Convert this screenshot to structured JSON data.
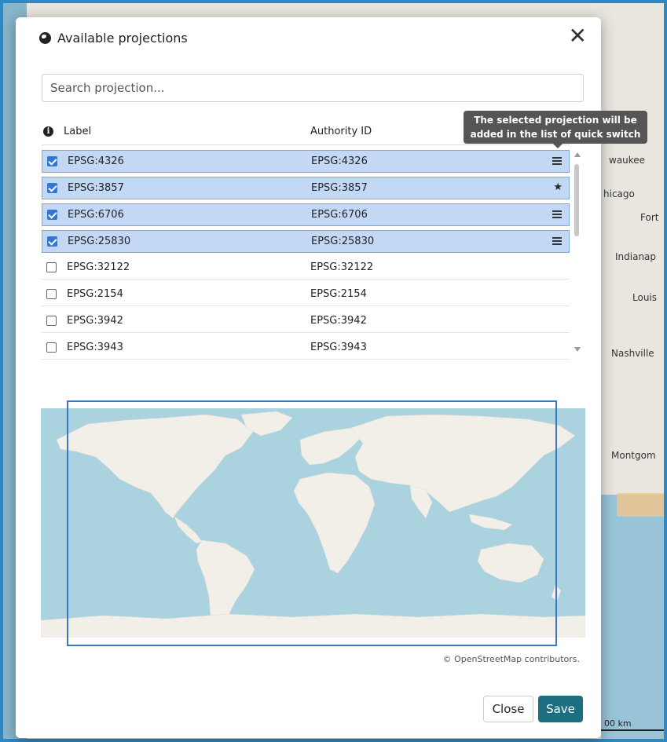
{
  "background": {
    "cities": [
      "waukee",
      "hicago",
      "Fort",
      "Indianap",
      "Louis",
      "Nashville",
      "Montgom"
    ],
    "scale_label": "00 km"
  },
  "dialog": {
    "title": "Available projections",
    "close_glyph": "✕",
    "search": {
      "placeholder": "Search projection...",
      "value": ""
    },
    "columns": {
      "label": "Label",
      "authority": "Authority ID"
    },
    "tooltip": {
      "line1": "The selected projection will be",
      "line2": "added in the list of quick switch"
    },
    "rows": [
      {
        "label": "EPSG:4326",
        "authority": "EPSG:4326",
        "selected": true,
        "action": "list-icon"
      },
      {
        "label": "EPSG:3857",
        "authority": "EPSG:3857",
        "selected": true,
        "action": "star-icon"
      },
      {
        "label": "EPSG:6706",
        "authority": "EPSG:6706",
        "selected": true,
        "action": "list-icon"
      },
      {
        "label": "EPSG:25830",
        "authority": "EPSG:25830",
        "selected": true,
        "action": "list-icon"
      },
      {
        "label": "EPSG:32122",
        "authority": "EPSG:32122",
        "selected": false,
        "action": ""
      },
      {
        "label": "EPSG:2154",
        "authority": "EPSG:2154",
        "selected": false,
        "action": ""
      },
      {
        "label": "EPSG:3942",
        "authority": "EPSG:3942",
        "selected": false,
        "action": ""
      },
      {
        "label": "EPSG:3943",
        "authority": "EPSG:3943",
        "selected": false,
        "action": ""
      }
    ],
    "attribution": "© OpenStreetMap contributors.",
    "buttons": {
      "close": "Close",
      "save": "Save"
    },
    "colors": {
      "selected_row": "#c2d8f4",
      "save_button": "#1b6f80",
      "extent_box": "#3a78c4",
      "ocean": "#aad3df",
      "land": "#f2efe9"
    }
  }
}
